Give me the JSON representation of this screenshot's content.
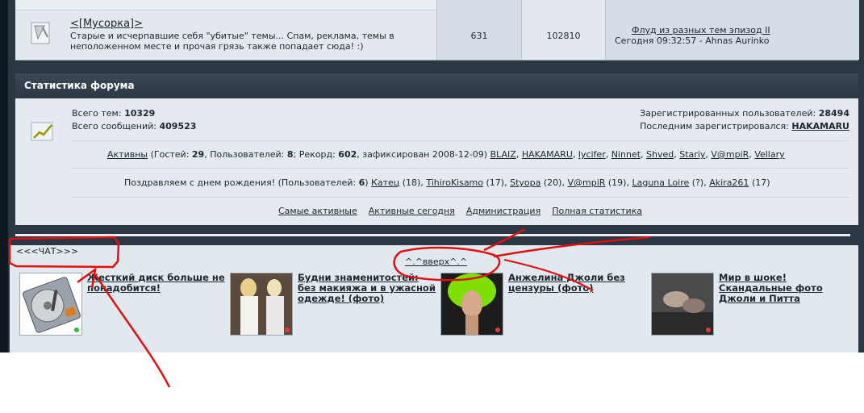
{
  "forum": {
    "title": "<[Мусорка]>",
    "description": "Старые и исчерпавшие себя \"убитые\" темы... Спам, реклама, темы в неположенном месте и прочая грязь также попадает сюда! :)",
    "topics": "631",
    "posts": "102810",
    "last_post_link": "Флуд из разных тем эпизод II",
    "last_post_info": "Сегодня 09:32:57 - Ahnas Aurinko"
  },
  "stats": {
    "header": "Статистика форума",
    "topics_label": "Всего тем:",
    "topics_value": "10329",
    "posts_label": "Всего сообщений:",
    "posts_value": "409523",
    "registered_label": "Зарегистрированных пользователей:",
    "registered_value": "28494",
    "last_registered_label": "Последним зарегистрировался:",
    "last_registered_user": "HAKAMARU",
    "active_link": "Активны",
    "active_guests_prefix": "(Гостей:",
    "active_guests": "29",
    "active_users_prefix": ", Пользователей:",
    "active_users": "8",
    "record_prefix": "; Рекорд:",
    "record_value": "602",
    "record_suffix": ", зафиксирован 2008-12-09)",
    "active_list": [
      "BLAIZ",
      "HAKAMARU",
      "lycifer",
      "Ninnet",
      "Shved",
      "Stariy",
      "V@mpiR",
      "Vellary"
    ],
    "birthday_text": "Поздравляем с днем рождения! (Пользователей:",
    "birthday_count": "6",
    "birthdays": [
      {
        "name": "Катец",
        "age": "(18)"
      },
      {
        "name": "TihiroKisamo",
        "age": "(17)"
      },
      {
        "name": "Styopa",
        "age": "(20)"
      },
      {
        "name": "V@mpiR",
        "age": "(19)"
      },
      {
        "name": "Laguna Loire",
        "age": "(?)"
      },
      {
        "name": "Akira261",
        "age": "(17)"
      }
    ],
    "bottom_links": [
      "Самые активные",
      "Активные сегодня",
      "Администрация",
      "Полная статистика"
    ]
  },
  "chat_label": "<<<ЧАТ>>>",
  "top_link": "^.^вверх^.^",
  "ads": [
    {
      "caption": "Жесткий диск больше не понадобится!",
      "status_color": "#2bbd3a"
    },
    {
      "caption": "Будни знаменитостей: без макияжа и в ужасной одежде! (фото)",
      "status_color": "#e23a3a"
    },
    {
      "caption": "Анжелина Джоли без цензуры (фото)",
      "status_color": "#e23a3a"
    },
    {
      "caption": "Мир в шоке! Скандальные фото Джоли и Питта",
      "status_color": "#e23a3a"
    }
  ],
  "annotation_color": "#e01010"
}
